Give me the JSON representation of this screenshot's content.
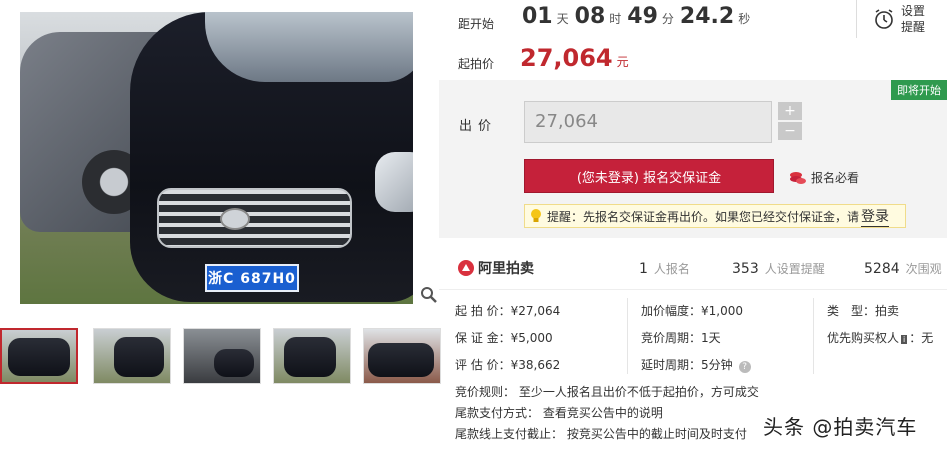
{
  "gallery": {
    "plate_text": "浙C 687H0",
    "thumbs": [
      "thumb-front",
      "thumb-side",
      "thumb-interior",
      "thumb-rear",
      "thumb-damage"
    ]
  },
  "auction": {
    "countdown_label": "距开始",
    "days": "01",
    "days_unit": "天",
    "hours": "08",
    "hours_unit": "时",
    "minutes": "49",
    "minutes_unit": "分",
    "seconds": "24.2",
    "seconds_unit": "秒",
    "start_price_label": "起拍价",
    "start_price": "27,064",
    "currency": "元",
    "reminder_line1": "设置",
    "reminder_line2": "提醒"
  },
  "bid": {
    "badge": "即将开始",
    "label": "出价",
    "value": "27,064",
    "plus": "+",
    "minus": "−",
    "deposit_button": "(您未登录) 报名交保证金",
    "must_read": "报名必看",
    "tip_text": "提醒：先报名交保证金再出价。如果您已经交付保证金，请",
    "tip_login": "登录"
  },
  "stats": {
    "logo_text": "阿里拍卖",
    "registered_count": "1",
    "registered_label": "人报名",
    "reminder_count": "353",
    "reminder_label": "人设置提醒",
    "views_count": "5284",
    "views_label": "次围观"
  },
  "details": {
    "start_price": "起 拍 价：¥27,064",
    "increment": "加价幅度：¥1,000",
    "type_label": "类　型：",
    "type_value": "拍卖",
    "deposit": "保 证 金：¥5,000",
    "cycle": "竞价周期：1天",
    "priority_label": "优先购买权人",
    "priority_value": "：无",
    "appraisal": "评 估 价：¥38,662",
    "delay": "延时周期：5分钟",
    "rule": "竞价规则：  至少一人报名且出价不低于起拍价，方可成交",
    "payment": "尾款支付方式：  查看竞买公告中的说明",
    "deadline": "尾款线上支付截止：  按竞买公告中的截止时间及时支付"
  },
  "watermark": "头条 @拍卖汽车",
  "colors": {
    "accent": "#c0282e",
    "button": "#c5213a",
    "badge": "#2f9a4e"
  }
}
